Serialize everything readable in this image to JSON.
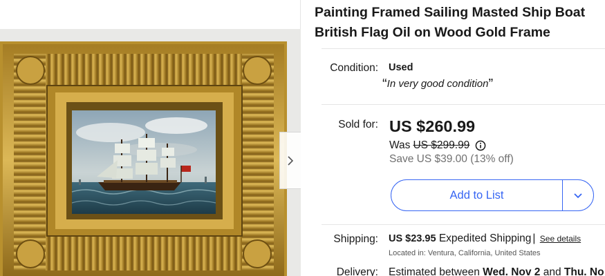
{
  "item": {
    "title_line1": "Painting Framed Sailing Masted Ship Boat",
    "title_line2": "British Flag Oil on Wood Gold Frame"
  },
  "condition": {
    "label": "Condition:",
    "value": "Used",
    "quote_open": "“",
    "quote": "In very good condition",
    "quote_close": "”"
  },
  "price": {
    "label": "Sold for:",
    "value": "US $260.99",
    "was_label": "Was",
    "was_value": "US $299.99",
    "save": "Save US $39.00 (13% off)"
  },
  "actions": {
    "add_to_list": "Add to List"
  },
  "shipping": {
    "label": "Shipping:",
    "cost": "US $23.95",
    "method": "Expedited Shipping",
    "separator": "|",
    "see_details": "See details",
    "location": "Located in: Ventura, California, United States"
  },
  "delivery": {
    "label": "Delivery:",
    "prefix": "Estimated between",
    "date1": "Wed. Nov 2",
    "and": "and",
    "date2": "Thu. No"
  },
  "icons": {
    "next": "chevron-right-icon",
    "caret": "chevron-down-icon",
    "info": "info-icon"
  },
  "colors": {
    "accent": "#3665f3",
    "text": "#191919",
    "muted": "#707070",
    "frame_gold": "#b8902e"
  }
}
